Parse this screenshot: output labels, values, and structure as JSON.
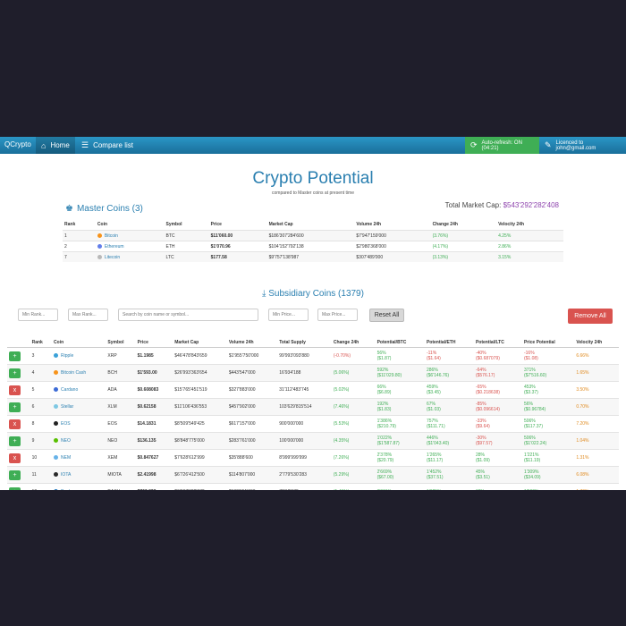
{
  "navbar": {
    "brand": "QCrypto",
    "home_label": "Home",
    "compare_label": "Compare list",
    "auto_refresh": "Auto-refresh: ON (04:21)",
    "licence": "Licenced to john@gmail.com"
  },
  "page": {
    "title": "Crypto Potential",
    "subtitle": "compared to Master coins at present time",
    "total_cap_label": "Total Market Cap:",
    "total_cap_value": "$543'292'282'408"
  },
  "master": {
    "heading": "Master Coins (3)",
    "columns": [
      "Rank",
      "Coin",
      "Symbol",
      "Price",
      "Market Cap",
      "Volume 24h",
      "Change 24h",
      "Velocity 24h"
    ],
    "rows": [
      {
        "rank": "1",
        "coin": "Bitcoin",
        "symbol": "BTC",
        "price": "$11'060.00",
        "market_cap": "$186'307'284'600",
        "volume": "$7'947'159'000",
        "change": "(3.76%)",
        "velocity": "4.25%"
      },
      {
        "rank": "2",
        "coin": "Ethereum",
        "symbol": "ETH",
        "price": "$1'070.96",
        "market_cap": "$104'152'792'138",
        "volume": "$2'980'368'000",
        "change": "(4.17%)",
        "velocity": "2.86%"
      },
      {
        "rank": "7",
        "coin": "Litecoin",
        "symbol": "LTC",
        "price": "$177.58",
        "market_cap": "$9'757'138'987",
        "volume": "$307'489'000",
        "change": "(3.13%)",
        "velocity": "3.15%"
      }
    ]
  },
  "subsidiary": {
    "heading": "Subsidiary Coins (1379)",
    "filters": {
      "min_rank": "Min Rank...",
      "max_rank": "Max Rank...",
      "search": "Search by coin name or symbol...",
      "min_price": "Min Price...",
      "max_price": "Max Price..."
    },
    "reset_label": "Reset All",
    "remove_all_label": "Remove All",
    "columns": [
      "Rank",
      "Coin",
      "Symbol",
      "Price",
      "Market Cap",
      "Volume 24h",
      "Total Supply",
      "Change 24h",
      "Potential/BTC",
      "Potential/ETH",
      "Potential/LTC",
      "Price Potential",
      "Velocity 24h"
    ],
    "rows": [
      {
        "action": "+",
        "rank": "3",
        "coin": "Ripple",
        "symbol": "XRP",
        "price": "$1.1985",
        "market_cap": "$46'478'843'659",
        "volume": "$1'955'750'000",
        "supply": "99'993'093'880",
        "change": "(-0.70%)",
        "p_btc": "56%",
        "p_btc2": "($1.87)",
        "p_eth": "-11%",
        "p_eth2": "($1.64)",
        "p_ltc": "-40%",
        "p_ltc2": "($0.687079)",
        "price_pot": "-16%",
        "price_pot2": "($1.08)",
        "velocity": "6.66%"
      },
      {
        "action": "+",
        "rank": "4",
        "coin": "Bitcoin Cash",
        "symbol": "BCH",
        "price": "$1'593.00",
        "market_cap": "$26'993'363'654",
        "volume": "$443'547'000",
        "supply": "16'934'188",
        "change": "(5.06%)",
        "p_btc": "592%",
        "p_btc2": "($11'029.80)",
        "p_eth": "286%",
        "p_eth2": "($6'146.76)",
        "p_ltc": "-64%",
        "p_ltc2": "($576.17)",
        "price_pot": "371%",
        "price_pot2": "($7'516.60)",
        "velocity": "1.65%"
      },
      {
        "action": "x",
        "rank": "5",
        "coin": "Cardano",
        "symbol": "ADA",
        "price": "$0.608083",
        "market_cap": "$15'765'451'519",
        "volume": "$327'883'000",
        "supply": "31'112'483'745",
        "change": "(5.02%)",
        "p_btc": "66%",
        "p_btc2": "($6.89)",
        "p_eth": "459%",
        "p_eth2": "($3.45)",
        "p_ltc": "-65%",
        "p_ltc2": "($0.218638)",
        "price_pot": "453%",
        "price_pot2": "($3.37)",
        "velocity": "3.50%"
      },
      {
        "action": "+",
        "rank": "6",
        "coin": "Stellar",
        "symbol": "XLM",
        "price": "$0.62158",
        "market_cap": "$11'106'436'553",
        "volume": "$457'902'000",
        "supply": "103'629'815'514",
        "change": "(7.46%)",
        "p_btc": "192%",
        "p_btc2": "($1.83)",
        "p_eth": "67%",
        "p_eth2": "($1.03)",
        "p_ltc": "-85%",
        "p_ltc2": "($0.096614)",
        "price_pot": "56%",
        "price_pot2": "($0.96784)",
        "velocity": "0.70%"
      },
      {
        "action": "x",
        "rank": "8",
        "coin": "EOS",
        "symbol": "EOS",
        "price": "$14.1831",
        "market_cap": "$8'509'549'425",
        "volume": "$617'157'000",
        "supply": "900'000'000",
        "change": "(5.53%)",
        "p_btc": "1'386%",
        "p_btc2": "($210.79)",
        "p_eth": "757%",
        "p_eth2": "($111.71)",
        "p_ltc": "-33%",
        "p_ltc2": "($9.64)",
        "price_pot": "506%",
        "price_pot2": "($117.37)",
        "velocity": "7.20%"
      },
      {
        "action": "+",
        "rank": "9",
        "coin": "NEO",
        "symbol": "NEO",
        "price": "$136.135",
        "market_cap": "$8'848'775'000",
        "volume": "$283'761'000",
        "supply": "100'000'000",
        "change": "(4.35%)",
        "p_btc": "1'022%",
        "p_btc2": "($1'587.87)",
        "p_eth": "446%",
        "p_eth2": "($1'043.40)",
        "p_ltc": "-30%",
        "p_ltc2": "($97.57)",
        "price_pot": "506%",
        "price_pot2": "($1'022.24)",
        "velocity": "1.04%"
      },
      {
        "action": "x",
        "rank": "10",
        "coin": "NEM",
        "symbol": "XEM",
        "price": "$0.847627",
        "market_cap": "$7'628'612'999",
        "volume": "$35'888'600",
        "supply": "8'999'999'999",
        "change": "(7.26%)",
        "p_btc": "2'378%",
        "p_btc2": "($20.79)",
        "p_eth": "1'265%",
        "p_eth2": "($11.17)",
        "p_ltc": "28%",
        "p_ltc2": "($1.09)",
        "price_pot": "1'221%",
        "price_pot2": "($11.19)",
        "velocity": "1.31%"
      },
      {
        "action": "+",
        "rank": "11",
        "coin": "IOTA",
        "symbol": "MIOTA",
        "price": "$2.41998",
        "market_cap": "$6'726'412'500",
        "volume": "$114'807'000",
        "supply": "2'779'530'283",
        "change": "(5.29%)",
        "p_btc": "2'669%",
        "p_btc2": "($67.00)",
        "p_eth": "1'452%",
        "p_eth2": "($37.51)",
        "p_ltc": "45%",
        "p_ltc2": "($3.51)",
        "price_pot": "1'309%",
        "price_pot2": "($34.09)",
        "velocity": "6.08%"
      },
      {
        "action": "+",
        "rank": "12",
        "coin": "Dash",
        "symbol": "DASH",
        "price": "$769.829",
        "market_cap": "$6'007'322'872",
        "volume": "$182'651'000",
        "supply": "7'812'078",
        "change": "(1.41%)",
        "p_btc": "3'001%",
        "p_btc2": "",
        "p_eth": "1'625%",
        "p_eth2": "",
        "p_ltc": "62%",
        "p_ltc2": "",
        "price_pot": "1'500%",
        "price_pot2": "",
        "velocity": "1.70%"
      }
    ]
  }
}
